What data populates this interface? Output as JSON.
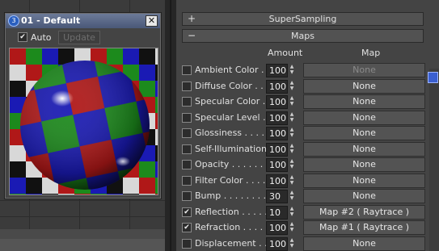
{
  "material_window": {
    "title": "01 - Default",
    "close_glyph": "✕",
    "auto_label": "Auto",
    "auto_checked": true,
    "update_label": "Update"
  },
  "panel": {
    "supersampling": {
      "sign": "+",
      "title": "SuperSampling"
    },
    "maps": {
      "sign": "−",
      "title": "Maps"
    },
    "columns": {
      "amount": "Amount",
      "map": "Map"
    },
    "rows": [
      {
        "label": "Ambient Color . .",
        "checked": false,
        "amount": "100",
        "map": "None",
        "dim": true
      },
      {
        "label": "Diffuse Color . . .",
        "checked": false,
        "amount": "100",
        "map": "None",
        "dim": false
      },
      {
        "label": "Specular Color . .",
        "checked": false,
        "amount": "100",
        "map": "None",
        "dim": false
      },
      {
        "label": "Specular Level . .",
        "checked": false,
        "amount": "100",
        "map": "None",
        "dim": false
      },
      {
        "label": "Glossiness . . . . .",
        "checked": false,
        "amount": "100",
        "map": "None",
        "dim": false
      },
      {
        "label": "Self-Illumination .",
        "checked": false,
        "amount": "100",
        "map": "None",
        "dim": false
      },
      {
        "label": "Opacity . . . . . . . .",
        "checked": false,
        "amount": "100",
        "map": "None",
        "dim": false
      },
      {
        "label": "Filter Color . . . .",
        "checked": false,
        "amount": "100",
        "map": "None",
        "dim": false
      },
      {
        "label": "Bump . . . . . . . . .",
        "checked": false,
        "amount": "30",
        "map": "None",
        "dim": false
      },
      {
        "label": "Reflection . . . . .",
        "checked": true,
        "amount": "10",
        "map": "Map #2  ( Raytrace )",
        "dim": false
      },
      {
        "label": "Refraction . . . . .",
        "checked": true,
        "amount": "100",
        "map": "Map #1  ( Raytrace )",
        "dim": false
      },
      {
        "label": "Displacement . .",
        "checked": false,
        "amount": "100",
        "map": "None",
        "dim": false
      }
    ]
  },
  "colors": {
    "checker": [
      "#b01818",
      "#1c8a1c",
      "#1a1ab4",
      "#111111",
      "#d8d8d8"
    ]
  },
  "icons": [
    "3dsmax-logo-icon",
    "close-icon",
    "checkbox-icon",
    "spinner-icon",
    "lock-icon"
  ]
}
